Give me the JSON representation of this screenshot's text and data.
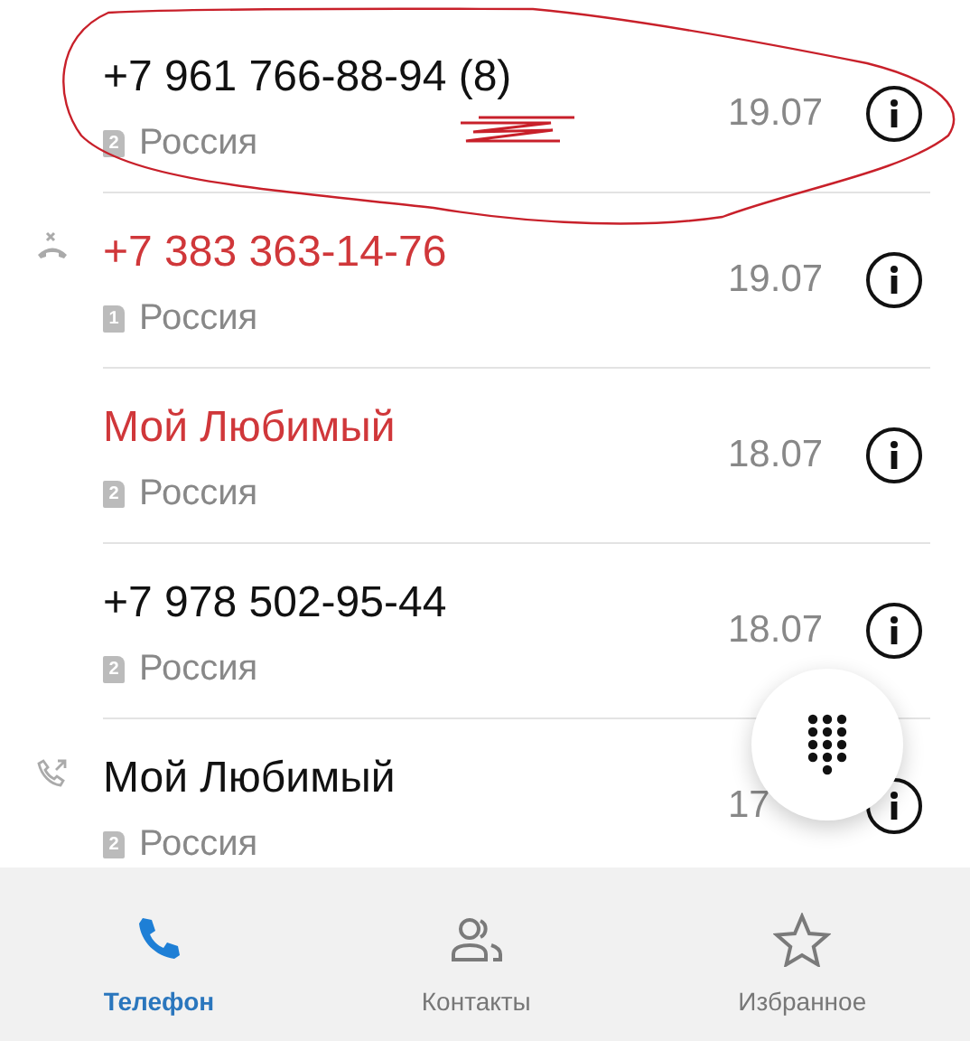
{
  "calls": [
    {
      "name": "+7 961 766-88-94 (8)",
      "missed": false,
      "kind": "none",
      "sim": "2",
      "location": "Россия",
      "date": "19.07"
    },
    {
      "name": "+7 383 363-14-76",
      "missed": true,
      "kind": "missed",
      "sim": "1",
      "location": "Россия",
      "date": "19.07"
    },
    {
      "name": "Мой Любимый",
      "missed": true,
      "kind": "none",
      "sim": "2",
      "location": "Россия",
      "date": "18.07"
    },
    {
      "name": "+7 978 502-95-44",
      "missed": false,
      "kind": "none",
      "sim": "2",
      "location": "Россия",
      "date": "18.07"
    },
    {
      "name": "Мой Любимый",
      "missed": false,
      "kind": "outgoing",
      "sim": "2",
      "location": "Россия",
      "date": "17"
    }
  ],
  "annotations": {
    "ellipse": true,
    "scribble": true
  },
  "tabs": [
    {
      "label": "Телефон",
      "selected": true
    },
    {
      "label": "Контакты",
      "selected": false
    },
    {
      "label": "Избранное",
      "selected": false
    }
  ]
}
